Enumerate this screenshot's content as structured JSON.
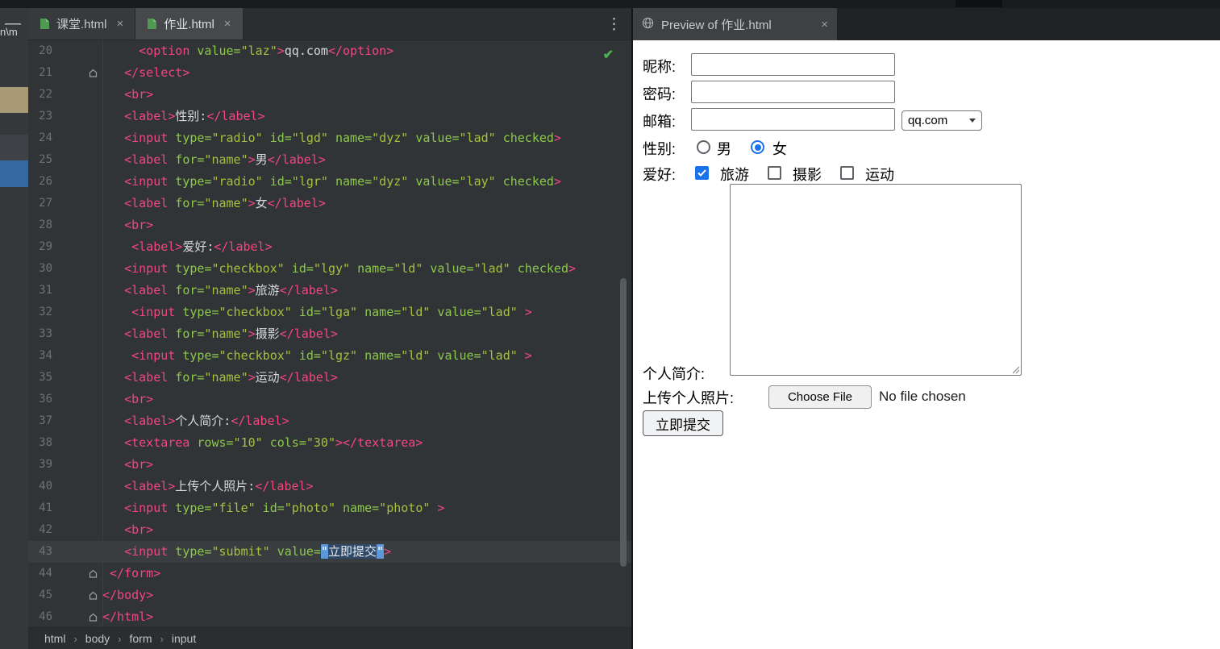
{
  "window": {
    "minimize_icon": "—",
    "panel_fragment": "n\\m"
  },
  "editor": {
    "tabs": [
      {
        "label": "课堂.html",
        "close_icon": "×"
      },
      {
        "label": "作业.html",
        "close_icon": "×"
      }
    ],
    "kebab_icon": "⋮",
    "inspection_check_icon": "✔",
    "breadcrumb": {
      "separator": "›",
      "items": [
        "html",
        "body",
        "form",
        "input"
      ]
    },
    "lines": [
      {
        "n": 20,
        "ind": 5,
        "tok": [
          [
            "g",
            "<option"
          ],
          [
            "a",
            " value="
          ],
          [
            "s",
            "\"laz\""
          ],
          [
            "g",
            ">"
          ],
          [
            "w",
            "qq.com"
          ],
          [
            "g",
            "</option>"
          ]
        ]
      },
      {
        "n": 21,
        "ind": 3,
        "fold": true,
        "tok": [
          [
            "g",
            "</select>"
          ]
        ]
      },
      {
        "n": 22,
        "ind": 3,
        "tok": [
          [
            "g",
            "<br>"
          ]
        ]
      },
      {
        "n": 23,
        "ind": 3,
        "tok": [
          [
            "g",
            "<label>"
          ],
          [
            "w",
            "性别:"
          ],
          [
            "g",
            "</label>"
          ]
        ]
      },
      {
        "n": 24,
        "ind": 3,
        "tok": [
          [
            "g",
            "<input"
          ],
          [
            "a",
            " type="
          ],
          [
            "s",
            "\"radio\""
          ],
          [
            "a",
            " id="
          ],
          [
            "s",
            "\"lgd\""
          ],
          [
            "a",
            " name="
          ],
          [
            "s",
            "\"dyz\""
          ],
          [
            "a",
            " value="
          ],
          [
            "s",
            "\"lad\""
          ],
          [
            "a",
            " checked"
          ],
          [
            "g",
            ">"
          ]
        ]
      },
      {
        "n": 25,
        "ind": 3,
        "tok": [
          [
            "g",
            "<label"
          ],
          [
            "a",
            " for="
          ],
          [
            "s",
            "\"name\""
          ],
          [
            "g",
            ">"
          ],
          [
            "w",
            "男"
          ],
          [
            "g",
            "</label>"
          ]
        ]
      },
      {
        "n": 26,
        "ind": 3,
        "tok": [
          [
            "g",
            "<input"
          ],
          [
            "a",
            " type="
          ],
          [
            "s",
            "\"radio\""
          ],
          [
            "a",
            " id="
          ],
          [
            "s",
            "\"lgr\""
          ],
          [
            "a",
            " name="
          ],
          [
            "s",
            "\"dyz\""
          ],
          [
            "a",
            " value="
          ],
          [
            "s",
            "\"lay\""
          ],
          [
            "a",
            " checked"
          ],
          [
            "g",
            ">"
          ]
        ]
      },
      {
        "n": 27,
        "ind": 3,
        "tok": [
          [
            "g",
            "<label"
          ],
          [
            "a",
            " for="
          ],
          [
            "s",
            "\"name\""
          ],
          [
            "g",
            ">"
          ],
          [
            "w",
            "女"
          ],
          [
            "g",
            "</label>"
          ]
        ]
      },
      {
        "n": 28,
        "ind": 3,
        "tok": [
          [
            "g",
            "<br>"
          ]
        ]
      },
      {
        "n": 29,
        "ind": 4,
        "tok": [
          [
            "g",
            "<label>"
          ],
          [
            "w",
            "爱好:"
          ],
          [
            "g",
            "</label>"
          ]
        ]
      },
      {
        "n": 30,
        "ind": 3,
        "tok": [
          [
            "g",
            "<input"
          ],
          [
            "a",
            " type="
          ],
          [
            "s",
            "\"checkbox\""
          ],
          [
            "a",
            " id="
          ],
          [
            "s",
            "\"lgy\""
          ],
          [
            "a",
            " name="
          ],
          [
            "s",
            "\"ld\""
          ],
          [
            "a",
            " value="
          ],
          [
            "s",
            "\"lad\""
          ],
          [
            "a",
            " checked"
          ],
          [
            "g",
            ">"
          ]
        ]
      },
      {
        "n": 31,
        "ind": 3,
        "tok": [
          [
            "g",
            "<label"
          ],
          [
            "a",
            " for="
          ],
          [
            "s",
            "\"name\""
          ],
          [
            "g",
            ">"
          ],
          [
            "w",
            "旅游"
          ],
          [
            "g",
            "</label>"
          ]
        ]
      },
      {
        "n": 32,
        "ind": 4,
        "tok": [
          [
            "g",
            "<input"
          ],
          [
            "a",
            " type="
          ],
          [
            "s",
            "\"checkbox\""
          ],
          [
            "a",
            " id="
          ],
          [
            "s",
            "\"lga\""
          ],
          [
            "a",
            " name="
          ],
          [
            "s",
            "\"ld\""
          ],
          [
            "a",
            " value="
          ],
          [
            "s",
            "\"lad\""
          ],
          [
            "g",
            " >"
          ]
        ]
      },
      {
        "n": 33,
        "ind": 3,
        "tok": [
          [
            "g",
            "<label"
          ],
          [
            "a",
            " for="
          ],
          [
            "s",
            "\"name\""
          ],
          [
            "g",
            ">"
          ],
          [
            "w",
            "摄影"
          ],
          [
            "g",
            "</label>"
          ]
        ]
      },
      {
        "n": 34,
        "ind": 4,
        "tok": [
          [
            "g",
            "<input"
          ],
          [
            "a",
            " type="
          ],
          [
            "s",
            "\"checkbox\""
          ],
          [
            "a",
            " id="
          ],
          [
            "s",
            "\"lgz\""
          ],
          [
            "a",
            " name="
          ],
          [
            "s",
            "\"ld\""
          ],
          [
            "a",
            " value="
          ],
          [
            "s",
            "\"lad\""
          ],
          [
            "g",
            " >"
          ]
        ]
      },
      {
        "n": 35,
        "ind": 3,
        "tok": [
          [
            "g",
            "<label"
          ],
          [
            "a",
            " for="
          ],
          [
            "s",
            "\"name\""
          ],
          [
            "g",
            ">"
          ],
          [
            "w",
            "运动"
          ],
          [
            "g",
            "</label>"
          ]
        ]
      },
      {
        "n": 36,
        "ind": 3,
        "tok": [
          [
            "g",
            "<br>"
          ]
        ]
      },
      {
        "n": 37,
        "ind": 3,
        "tok": [
          [
            "g",
            "<label>"
          ],
          [
            "w",
            "个人简介:"
          ],
          [
            "g",
            "</label>"
          ]
        ]
      },
      {
        "n": 38,
        "ind": 3,
        "tok": [
          [
            "g",
            "<textarea"
          ],
          [
            "a",
            " rows="
          ],
          [
            "s",
            "\"10\""
          ],
          [
            "a",
            " cols="
          ],
          [
            "s",
            "\"30\""
          ],
          [
            "g",
            "></textarea>"
          ]
        ]
      },
      {
        "n": 39,
        "ind": 3,
        "tok": [
          [
            "g",
            "<br>"
          ]
        ]
      },
      {
        "n": 40,
        "ind": 3,
        "tok": [
          [
            "g",
            "<label>"
          ],
          [
            "w",
            "上传个人照片:"
          ],
          [
            "g",
            "</label>"
          ]
        ]
      },
      {
        "n": 41,
        "ind": 3,
        "tok": [
          [
            "g",
            "<input"
          ],
          [
            "a",
            " type="
          ],
          [
            "s",
            "\"file\""
          ],
          [
            "a",
            " id="
          ],
          [
            "s",
            "\"photo\""
          ],
          [
            "a",
            " name="
          ],
          [
            "s",
            "\"photo\""
          ],
          [
            "g",
            " >"
          ]
        ]
      },
      {
        "n": 42,
        "ind": 3,
        "tok": [
          [
            "g",
            "<br>"
          ]
        ]
      },
      {
        "n": 43,
        "ind": 3,
        "cur": true,
        "tok": [
          [
            "g",
            "<input"
          ],
          [
            "a",
            " type="
          ],
          [
            "s",
            "\"submit\""
          ],
          [
            "a",
            " value="
          ],
          [
            "q",
            "\""
          ],
          [
            "v",
            "立即提交"
          ],
          [
            "q",
            "\""
          ],
          [
            "g",
            ">"
          ]
        ]
      },
      {
        "n": 44,
        "ind": 1,
        "fold": true,
        "tok": [
          [
            "g",
            "</form>"
          ]
        ]
      },
      {
        "n": 45,
        "ind": 0,
        "fold": true,
        "tok": [
          [
            "g",
            "</body>"
          ]
        ]
      },
      {
        "n": 46,
        "ind": 0,
        "fold": true,
        "tok": [
          [
            "g",
            "</html>"
          ]
        ]
      }
    ]
  },
  "preview": {
    "title": "Preview of 作业.html",
    "close_icon": "×",
    "form": {
      "nickname_label": "昵称:",
      "password_label": "密码:",
      "email_label": "邮箱:",
      "email_domain_selected": "qq.com",
      "gender": {
        "label": "性别:",
        "options": [
          {
            "label": "男",
            "checked": false
          },
          {
            "label": "女",
            "checked": true
          }
        ]
      },
      "hobby": {
        "label": "爱好:",
        "options": [
          {
            "label": "旅游",
            "checked": true
          },
          {
            "label": "摄影",
            "checked": false
          },
          {
            "label": "运动",
            "checked": false
          }
        ]
      },
      "bio_label": "个人简介:",
      "upload_label": "上传个人照片:",
      "choose_file_button": "Choose File",
      "file_status": "No file chosen",
      "submit_button": "立即提交"
    }
  },
  "colors": {
    "accent_blue": "#1a73e8",
    "tag_pink": "#f2477e",
    "attr_green": "#8cc84c",
    "string_olive": "#aabf3e",
    "check_green": "#4db151"
  }
}
